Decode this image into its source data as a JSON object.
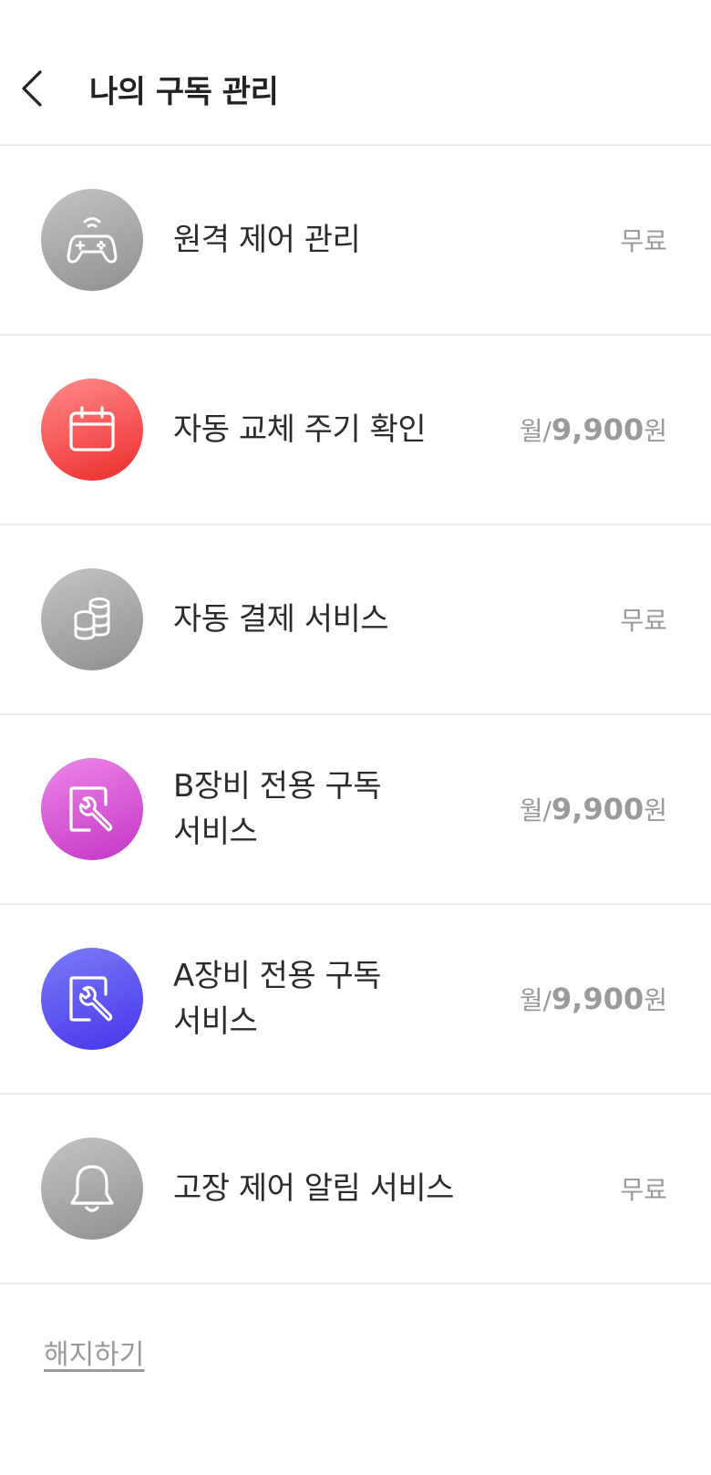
{
  "header": {
    "title": "나의 구독 관리"
  },
  "items": [
    {
      "name": "원격 제어 관리",
      "price_text": "무료"
    },
    {
      "name": "자동 교체 주기 확인",
      "price_prefix": "월/",
      "price_amount": "9,900",
      "price_suffix": "원"
    },
    {
      "name": "자동 결제 서비스",
      "price_text": "무료"
    },
    {
      "name_line1": "B장비 전용 구독",
      "name_line2": "서비스",
      "price_prefix": "월/",
      "price_amount": "9,900",
      "price_suffix": "원"
    },
    {
      "name_line1": "A장비 전용 구독",
      "name_line2": "서비스",
      "price_prefix": "월/",
      "price_amount": "9,900",
      "price_suffix": "원"
    },
    {
      "name": "고장 제어 알림 서비스",
      "price_text": "무료"
    }
  ],
  "footer": {
    "cancel_label": "해지하기"
  }
}
